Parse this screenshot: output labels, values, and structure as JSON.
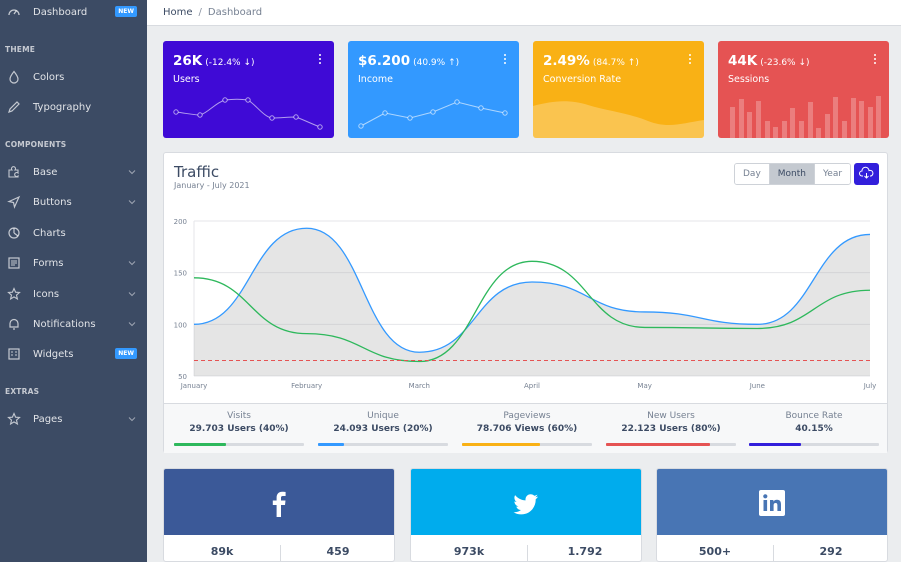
{
  "sidebar": {
    "top_item": {
      "label": "Dashboard",
      "badge": "NEW",
      "icon": "speedometer-icon"
    },
    "sections": [
      {
        "title": "THEME"
      },
      {
        "title": "COMPONENTS"
      },
      {
        "title": "EXTRAS"
      }
    ],
    "items": [
      {
        "label": "Colors",
        "icon": "drop-icon"
      },
      {
        "label": "Typography",
        "icon": "pencil-icon"
      },
      {
        "label": "Base",
        "icon": "puzzle-icon"
      },
      {
        "label": "Buttons",
        "icon": "cursor-icon"
      },
      {
        "label": "Charts",
        "icon": "chart-pie-icon"
      },
      {
        "label": "Forms",
        "icon": "notes-icon"
      },
      {
        "label": "Icons",
        "icon": "star-icon"
      },
      {
        "label": "Notifications",
        "icon": "bell-icon"
      },
      {
        "label": "Widgets",
        "icon": "calculator-icon",
        "badge": "NEW"
      },
      {
        "label": "Pages",
        "icon": "star-icon"
      }
    ]
  },
  "breadcrumb": {
    "home": "Home",
    "separator": "/",
    "current": "Dashboard"
  },
  "stat_cards": [
    {
      "value": "26K",
      "change": "(-12.4% ↓)",
      "label": "Users",
      "color": "#321fdb"
    },
    {
      "value": "$6.200",
      "change": "(40.9% ↑)",
      "label": "Income",
      "color": "#3399ff"
    },
    {
      "value": "2.49%",
      "change": "(84.7% ↑)",
      "label": "Conversion Rate",
      "color": "#f9b115"
    },
    {
      "value": "44K",
      "change": "(-23.6% ↓)",
      "label": "Sessions",
      "color": "#e55353"
    }
  ],
  "traffic": {
    "title": "Traffic",
    "subtitle": "January - July 2021",
    "buttons": {
      "day": "Day",
      "month": "Month",
      "year": "Year"
    },
    "selected": "Month"
  },
  "chart_data": {
    "type": "line",
    "categories": [
      "January",
      "February",
      "March",
      "April",
      "May",
      "June",
      "July"
    ],
    "ylim": [
      50,
      200
    ],
    "yticks": [
      "200",
      "150",
      "100",
      "50"
    ],
    "series": [
      {
        "color": "#3399ff",
        "fill": true,
        "values": [
          100,
          193,
          73,
          141,
          112,
          100,
          187
        ]
      },
      {
        "color": "#2eb85c",
        "fill": false,
        "values": [
          145,
          91,
          64,
          161,
          97,
          96,
          133
        ]
      },
      {
        "color": "#e55353",
        "dashed": true,
        "values": [
          65,
          65,
          65,
          65,
          65,
          65,
          65
        ]
      }
    ]
  },
  "footer_stats": [
    {
      "label": "Visits",
      "value": "29.703 Users (40%)",
      "progress": 40,
      "color": "#2eb85c"
    },
    {
      "label": "Unique",
      "value": "24.093 Users (20%)",
      "progress": 20,
      "color": "#3399ff"
    },
    {
      "label": "Pageviews",
      "value": "78.706 Views (60%)",
      "progress": 60,
      "color": "#f9b115"
    },
    {
      "label": "New Users",
      "value": "22.123 Users (80%)",
      "progress": 80,
      "color": "#e55353"
    },
    {
      "label": "Bounce Rate",
      "value": "40.15%",
      "progress": 40,
      "color": "#321fdb"
    }
  ],
  "social": [
    {
      "network": "facebook-icon",
      "color": "#3b5998",
      "left_value": "89k",
      "right_value": "459"
    },
    {
      "network": "twitter-icon",
      "color": "#00aced",
      "left_value": "973k",
      "right_value": "1.792"
    },
    {
      "network": "linkedin-icon",
      "color": "#4875b4",
      "left_value": "500+",
      "right_value": "292"
    }
  ]
}
